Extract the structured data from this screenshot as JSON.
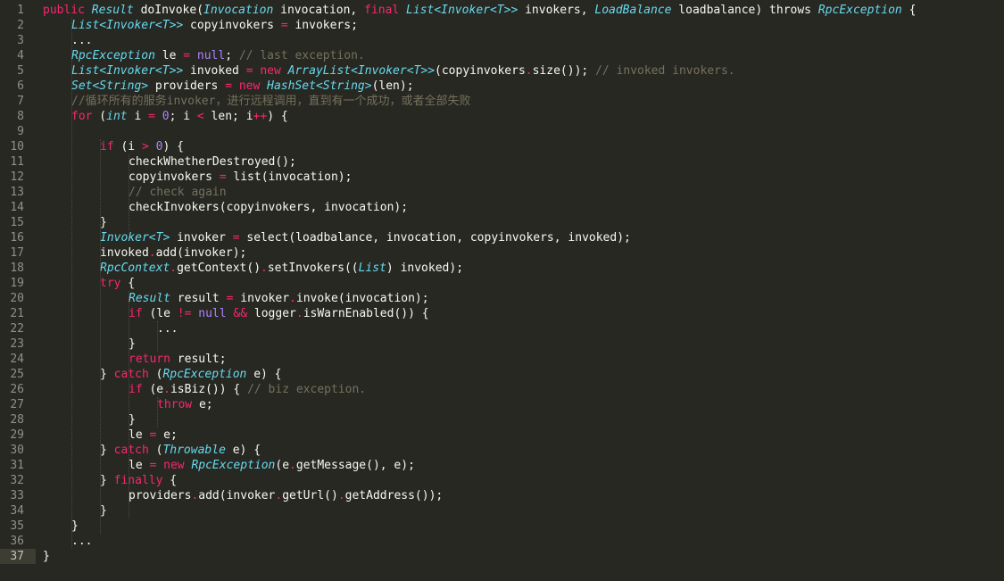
{
  "editor": {
    "active_line": 37,
    "theme_colors": {
      "background": "#272822",
      "keyword": "#f92672",
      "type": "#66d9ef",
      "number": "#ae81ff",
      "comment": "#75715e",
      "text": "#f8f8f2"
    },
    "lines": [
      {
        "n": "1",
        "indent": 0,
        "tokens": [
          [
            "kw",
            "public"
          ],
          [
            "pl",
            " "
          ],
          [
            "type",
            "Result"
          ],
          [
            "pl",
            " doInvoke("
          ],
          [
            "type",
            "Invocation"
          ],
          [
            "pl",
            " invocation, "
          ],
          [
            "kw",
            "final"
          ],
          [
            "pl",
            " "
          ],
          [
            "type",
            "List<Invoker<T>>"
          ],
          [
            "pl",
            " invokers, "
          ],
          [
            "type",
            "LoadBalance"
          ],
          [
            "pl",
            " loadbalance) "
          ],
          [
            "pl",
            "throws"
          ],
          [
            "pl",
            " "
          ],
          [
            "type",
            "RpcException"
          ],
          [
            "pl",
            " {"
          ]
        ]
      },
      {
        "n": "2",
        "indent": 1,
        "tokens": [
          [
            "type",
            "List<Invoker<T>>"
          ],
          [
            "pl",
            " copyinvokers "
          ],
          [
            "op",
            "="
          ],
          [
            "pl",
            " invokers;"
          ]
        ]
      },
      {
        "n": "3",
        "indent": 1,
        "tokens": [
          [
            "pl",
            "..."
          ]
        ]
      },
      {
        "n": "4",
        "indent": 1,
        "tokens": [
          [
            "type",
            "RpcException"
          ],
          [
            "pl",
            " le "
          ],
          [
            "op",
            "="
          ],
          [
            "pl",
            " "
          ],
          [
            "const",
            "null"
          ],
          [
            "pl",
            "; "
          ],
          [
            "cm",
            "// last exception."
          ]
        ]
      },
      {
        "n": "5",
        "indent": 1,
        "tokens": [
          [
            "type",
            "List<Invoker<T>>"
          ],
          [
            "pl",
            " invoked "
          ],
          [
            "op",
            "="
          ],
          [
            "pl",
            " "
          ],
          [
            "kw",
            "new"
          ],
          [
            "pl",
            " "
          ],
          [
            "type",
            "ArrayList<Invoker<T>>"
          ],
          [
            "pl",
            "(copyinvokers"
          ],
          [
            "op",
            "."
          ],
          [
            "pl",
            "size()); "
          ],
          [
            "cm",
            "// invoked invokers."
          ]
        ]
      },
      {
        "n": "6",
        "indent": 1,
        "tokens": [
          [
            "type",
            "Set<String>"
          ],
          [
            "pl",
            " providers "
          ],
          [
            "op",
            "="
          ],
          [
            "pl",
            " "
          ],
          [
            "kw",
            "new"
          ],
          [
            "pl",
            " "
          ],
          [
            "type",
            "HashSet<String>"
          ],
          [
            "pl",
            "(len);"
          ]
        ]
      },
      {
        "n": "7",
        "indent": 1,
        "tokens": [
          [
            "cm",
            "//循环所有的服务invoker，进行远程调用，直到有一个成功，或者全部失败"
          ]
        ]
      },
      {
        "n": "8",
        "indent": 1,
        "tokens": [
          [
            "kw",
            "for"
          ],
          [
            "pl",
            " ("
          ],
          [
            "type",
            "int"
          ],
          [
            "pl",
            " i "
          ],
          [
            "op",
            "="
          ],
          [
            "pl",
            " "
          ],
          [
            "num",
            "0"
          ],
          [
            "pl",
            "; i "
          ],
          [
            "op",
            "<"
          ],
          [
            "pl",
            " len; i"
          ],
          [
            "op",
            "++"
          ],
          [
            "pl",
            ") {"
          ]
        ]
      },
      {
        "n": "9",
        "indent": 0,
        "tokens": []
      },
      {
        "n": "10",
        "indent": 2,
        "tokens": [
          [
            "kw",
            "if"
          ],
          [
            "pl",
            " (i "
          ],
          [
            "op",
            ">"
          ],
          [
            "pl",
            " "
          ],
          [
            "num",
            "0"
          ],
          [
            "pl",
            ") {"
          ]
        ]
      },
      {
        "n": "11",
        "indent": 3,
        "tokens": [
          [
            "pl",
            "checkWhetherDestroyed();"
          ]
        ]
      },
      {
        "n": "12",
        "indent": 3,
        "tokens": [
          [
            "pl",
            "copyinvokers "
          ],
          [
            "op",
            "="
          ],
          [
            "pl",
            " list(invocation);"
          ]
        ]
      },
      {
        "n": "13",
        "indent": 3,
        "tokens": [
          [
            "cm",
            "// check again"
          ]
        ]
      },
      {
        "n": "14",
        "indent": 3,
        "tokens": [
          [
            "pl",
            "checkInvokers(copyinvokers, invocation);"
          ]
        ]
      },
      {
        "n": "15",
        "indent": 2,
        "tokens": [
          [
            "pl",
            "}"
          ]
        ]
      },
      {
        "n": "16",
        "indent": 2,
        "tokens": [
          [
            "type",
            "Invoker<T>"
          ],
          [
            "pl",
            " invoker "
          ],
          [
            "op",
            "="
          ],
          [
            "pl",
            " select(loadbalance, invocation, copyinvokers, invoked);"
          ]
        ]
      },
      {
        "n": "17",
        "indent": 2,
        "tokens": [
          [
            "pl",
            "invoked"
          ],
          [
            "op",
            "."
          ],
          [
            "pl",
            "add(invoker);"
          ]
        ]
      },
      {
        "n": "18",
        "indent": 2,
        "tokens": [
          [
            "type",
            "RpcContext"
          ],
          [
            "op",
            "."
          ],
          [
            "pl",
            "getContext()"
          ],
          [
            "op",
            "."
          ],
          [
            "pl",
            "setInvokers(("
          ],
          [
            "type",
            "List"
          ],
          [
            "pl",
            ") invoked);"
          ]
        ]
      },
      {
        "n": "19",
        "indent": 2,
        "tokens": [
          [
            "kw",
            "try"
          ],
          [
            "pl",
            " {"
          ]
        ]
      },
      {
        "n": "20",
        "indent": 3,
        "tokens": [
          [
            "type",
            "Result"
          ],
          [
            "pl",
            " result "
          ],
          [
            "op",
            "="
          ],
          [
            "pl",
            " invoker"
          ],
          [
            "op",
            "."
          ],
          [
            "pl",
            "invoke(invocation);"
          ]
        ]
      },
      {
        "n": "21",
        "indent": 3,
        "tokens": [
          [
            "kw",
            "if"
          ],
          [
            "pl",
            " (le "
          ],
          [
            "op",
            "!="
          ],
          [
            "pl",
            " "
          ],
          [
            "const",
            "null"
          ],
          [
            "pl",
            " "
          ],
          [
            "op",
            "&&"
          ],
          [
            "pl",
            " logger"
          ],
          [
            "op",
            "."
          ],
          [
            "pl",
            "isWarnEnabled()) {"
          ]
        ]
      },
      {
        "n": "22",
        "indent": 4,
        "tokens": [
          [
            "pl",
            "..."
          ]
        ]
      },
      {
        "n": "23",
        "indent": 3,
        "tokens": [
          [
            "pl",
            "}"
          ]
        ]
      },
      {
        "n": "24",
        "indent": 3,
        "tokens": [
          [
            "kw",
            "return"
          ],
          [
            "pl",
            " result;"
          ]
        ]
      },
      {
        "n": "25",
        "indent": 2,
        "tokens": [
          [
            "pl",
            "} "
          ],
          [
            "kw",
            "catch"
          ],
          [
            "pl",
            " ("
          ],
          [
            "type",
            "RpcException"
          ],
          [
            "pl",
            " e) {"
          ]
        ]
      },
      {
        "n": "26",
        "indent": 3,
        "tokens": [
          [
            "kw",
            "if"
          ],
          [
            "pl",
            " (e"
          ],
          [
            "op",
            "."
          ],
          [
            "pl",
            "isBiz()) { "
          ],
          [
            "cm",
            "// biz exception."
          ]
        ]
      },
      {
        "n": "27",
        "indent": 4,
        "tokens": [
          [
            "kw",
            "throw"
          ],
          [
            "pl",
            " e;"
          ]
        ]
      },
      {
        "n": "28",
        "indent": 3,
        "tokens": [
          [
            "pl",
            "}"
          ]
        ]
      },
      {
        "n": "29",
        "indent": 3,
        "tokens": [
          [
            "pl",
            "le "
          ],
          [
            "op",
            "="
          ],
          [
            "pl",
            " e;"
          ]
        ]
      },
      {
        "n": "30",
        "indent": 2,
        "tokens": [
          [
            "pl",
            "} "
          ],
          [
            "kw",
            "catch"
          ],
          [
            "pl",
            " ("
          ],
          [
            "type",
            "Throwable"
          ],
          [
            "pl",
            " e) {"
          ]
        ]
      },
      {
        "n": "31",
        "indent": 3,
        "tokens": [
          [
            "pl",
            "le "
          ],
          [
            "op",
            "="
          ],
          [
            "pl",
            " "
          ],
          [
            "kw",
            "new"
          ],
          [
            "pl",
            " "
          ],
          [
            "type",
            "RpcException"
          ],
          [
            "pl",
            "(e"
          ],
          [
            "op",
            "."
          ],
          [
            "pl",
            "getMessage(), e);"
          ]
        ]
      },
      {
        "n": "32",
        "indent": 2,
        "tokens": [
          [
            "pl",
            "} "
          ],
          [
            "kw",
            "finally"
          ],
          [
            "pl",
            " {"
          ]
        ]
      },
      {
        "n": "33",
        "indent": 3,
        "tokens": [
          [
            "pl",
            "providers"
          ],
          [
            "op",
            "."
          ],
          [
            "pl",
            "add(invoker"
          ],
          [
            "op",
            "."
          ],
          [
            "pl",
            "getUrl()"
          ],
          [
            "op",
            "."
          ],
          [
            "pl",
            "getAddress());"
          ]
        ]
      },
      {
        "n": "34",
        "indent": 2,
        "tokens": [
          [
            "pl",
            "}"
          ]
        ]
      },
      {
        "n": "35",
        "indent": 1,
        "tokens": [
          [
            "pl",
            "}"
          ]
        ]
      },
      {
        "n": "36",
        "indent": 1,
        "tokens": [
          [
            "pl",
            "..."
          ]
        ]
      },
      {
        "n": "37",
        "indent": 0,
        "tokens": [
          [
            "pl",
            "}"
          ]
        ]
      }
    ]
  }
}
